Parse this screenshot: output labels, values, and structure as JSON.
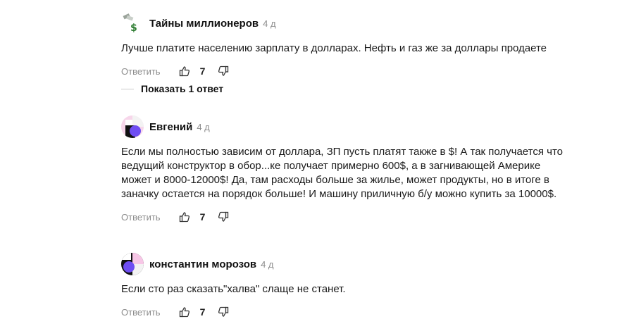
{
  "comments": [
    {
      "author": "Тайны миллионеров",
      "time": "4 д",
      "text": "Лучше платите населению зарплату в долларах. Нефть и газ же за доллары продаете",
      "reply_label": "Ответить",
      "likes": "7"
    },
    {
      "author": "Евгений",
      "time": "4 д",
      "text": "Если мы полностью зависим от доллара, ЗП пусть платят также в $! А так получается что ведущий конструктор в обор...ке получает примерно 600$, а в загнивающей Америке может и 8000-12000$! Да, там расходы больше за жилье, может продукты, но в итоге в заначку остается на порядок больше! И машину приличную б/у можно купить за 10000$.",
      "reply_label": "Ответить",
      "likes": "7"
    },
    {
      "author": "константин морозов",
      "time": "4 д",
      "text": "Если сто раз сказать\"халва\" слаще не станет.",
      "reply_label": "Ответить",
      "likes": "7"
    }
  ],
  "show_replies_label": "Показать 1 ответ"
}
